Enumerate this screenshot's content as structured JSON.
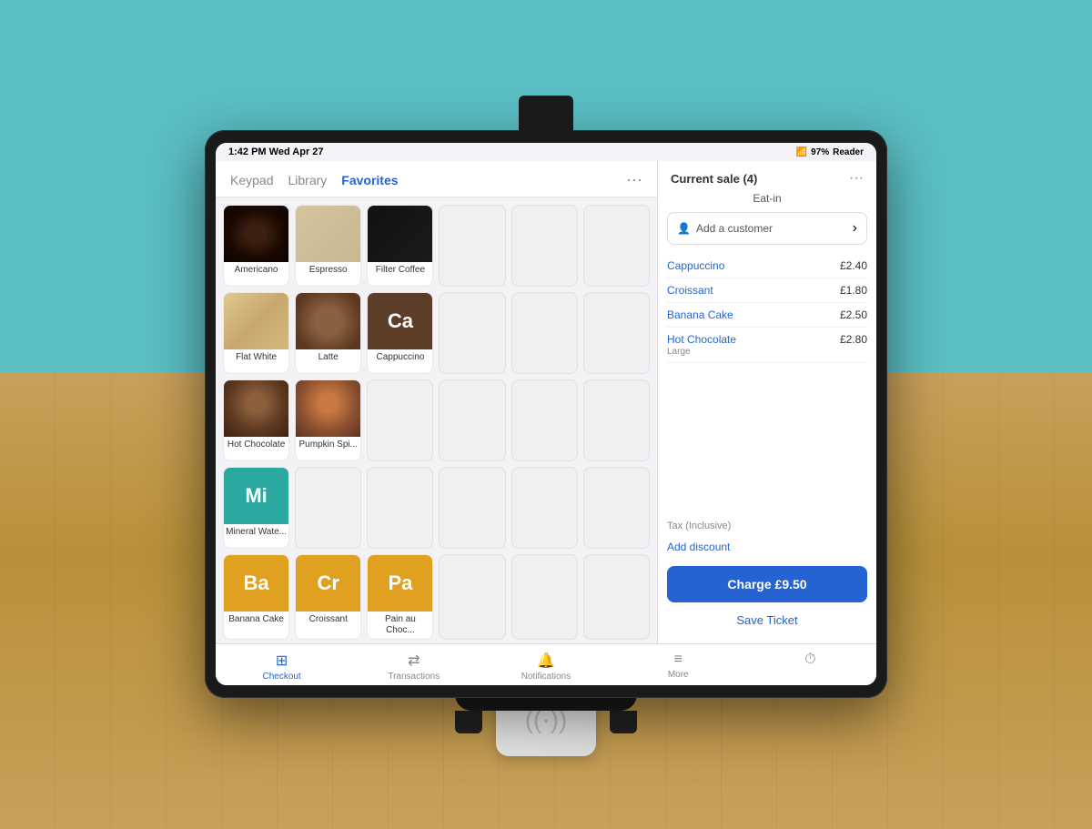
{
  "background": {
    "wall_color": "#5bbfc4",
    "table_color": "#c8a05a"
  },
  "status_bar": {
    "time": "1:42 PM",
    "date": "Wed Apr 27",
    "battery": "97%",
    "reader_label": "Reader"
  },
  "tabs": {
    "keypad": "Keypad",
    "library": "Library",
    "favorites": "Favorites",
    "active": "Favorites"
  },
  "more_icon": "···",
  "products": [
    {
      "id": "americano",
      "name": "Americano",
      "type": "image",
      "image_class": "img-americano",
      "empty": false
    },
    {
      "id": "espresso",
      "name": "Espresso",
      "type": "image",
      "image_class": "img-espresso",
      "empty": false
    },
    {
      "id": "filter-coffee",
      "name": "Filter Coffee",
      "type": "image",
      "image_class": "img-filter",
      "empty": false
    },
    {
      "id": "empty1",
      "name": "",
      "type": "empty",
      "empty": true
    },
    {
      "id": "empty2",
      "name": "",
      "type": "empty",
      "empty": true
    },
    {
      "id": "empty3",
      "name": "",
      "type": "empty",
      "empty": true
    },
    {
      "id": "flat-white",
      "name": "Flat White",
      "type": "image",
      "image_class": "img-flatwhite",
      "empty": false
    },
    {
      "id": "latte",
      "name": "Latte",
      "type": "image",
      "image_class": "img-latte",
      "empty": false
    },
    {
      "id": "cappuccino",
      "name": "Cappuccino",
      "type": "tile",
      "tile_class": "img-cappuccino-tile",
      "tile_label": "Ca",
      "empty": false
    },
    {
      "id": "empty4",
      "name": "",
      "type": "empty",
      "empty": true
    },
    {
      "id": "empty5",
      "name": "",
      "type": "empty",
      "empty": true
    },
    {
      "id": "empty6",
      "name": "",
      "type": "empty",
      "empty": true
    },
    {
      "id": "hot-chocolate",
      "name": "Hot Chocolate",
      "type": "image",
      "image_class": "img-hotchoc",
      "empty": false
    },
    {
      "id": "pumpkin-spice",
      "name": "Pumpkin Spi...",
      "type": "image",
      "image_class": "img-pumpkin",
      "empty": false
    },
    {
      "id": "empty7",
      "name": "",
      "type": "empty",
      "empty": true
    },
    {
      "id": "empty8",
      "name": "",
      "type": "empty",
      "empty": true
    },
    {
      "id": "empty9",
      "name": "",
      "type": "empty",
      "empty": true
    },
    {
      "id": "empty10",
      "name": "",
      "type": "empty",
      "empty": true
    },
    {
      "id": "mineral-water",
      "name": "Mineral Wate...",
      "type": "tile",
      "tile_class": "img-mineral-tile",
      "tile_label": "Mi",
      "empty": false
    },
    {
      "id": "empty11",
      "name": "",
      "type": "empty",
      "empty": true
    },
    {
      "id": "empty12",
      "name": "",
      "type": "empty",
      "empty": true
    },
    {
      "id": "empty13",
      "name": "",
      "type": "empty",
      "empty": true
    },
    {
      "id": "empty14",
      "name": "",
      "type": "empty",
      "empty": true
    },
    {
      "id": "empty15",
      "name": "",
      "type": "empty",
      "empty": true
    },
    {
      "id": "banana-cake",
      "name": "Banana Cake",
      "type": "tile",
      "tile_class": "img-banana-tile",
      "tile_label": "Ba",
      "empty": false
    },
    {
      "id": "croissant",
      "name": "Croissant",
      "type": "tile",
      "tile_class": "img-croissant-tile",
      "tile_label": "Cr",
      "empty": false
    },
    {
      "id": "pain-au-choc",
      "name": "Pain au Choc...",
      "type": "tile",
      "tile_class": "img-pain-tile",
      "tile_label": "Pa",
      "empty": false
    },
    {
      "id": "empty16",
      "name": "",
      "type": "empty",
      "empty": true
    },
    {
      "id": "empty17",
      "name": "",
      "type": "empty",
      "empty": true
    },
    {
      "id": "empty18",
      "name": "",
      "type": "empty",
      "empty": true
    }
  ],
  "right_panel": {
    "title": "Current sale (4)",
    "sale_type": "Eat-in",
    "add_customer": "Add a customer",
    "order_items": [
      {
        "name": "Cappuccino",
        "sub": "",
        "price": "£2.40"
      },
      {
        "name": "Croissant",
        "sub": "",
        "price": "£1.80"
      },
      {
        "name": "Banana Cake",
        "sub": "",
        "price": "£2.50"
      },
      {
        "name": "Hot Chocolate",
        "sub": "Large",
        "price": "£2.80"
      }
    ],
    "tax_label": "Tax (Inclusive)",
    "add_discount": "Add discount",
    "charge_label": "Charge £9.50",
    "save_ticket": "Save Ticket"
  },
  "bottom_nav": [
    {
      "id": "checkout",
      "icon": "⊞",
      "label": "Checkout",
      "active": true
    },
    {
      "id": "transactions",
      "icon": "⇄",
      "label": "Transactions",
      "active": false
    },
    {
      "id": "notifications",
      "icon": "🔔",
      "label": "Notifications",
      "active": false
    },
    {
      "id": "more",
      "icon": "≡",
      "label": "More",
      "active": false
    },
    {
      "id": "clock",
      "icon": "⏱",
      "label": "",
      "active": false
    }
  ]
}
